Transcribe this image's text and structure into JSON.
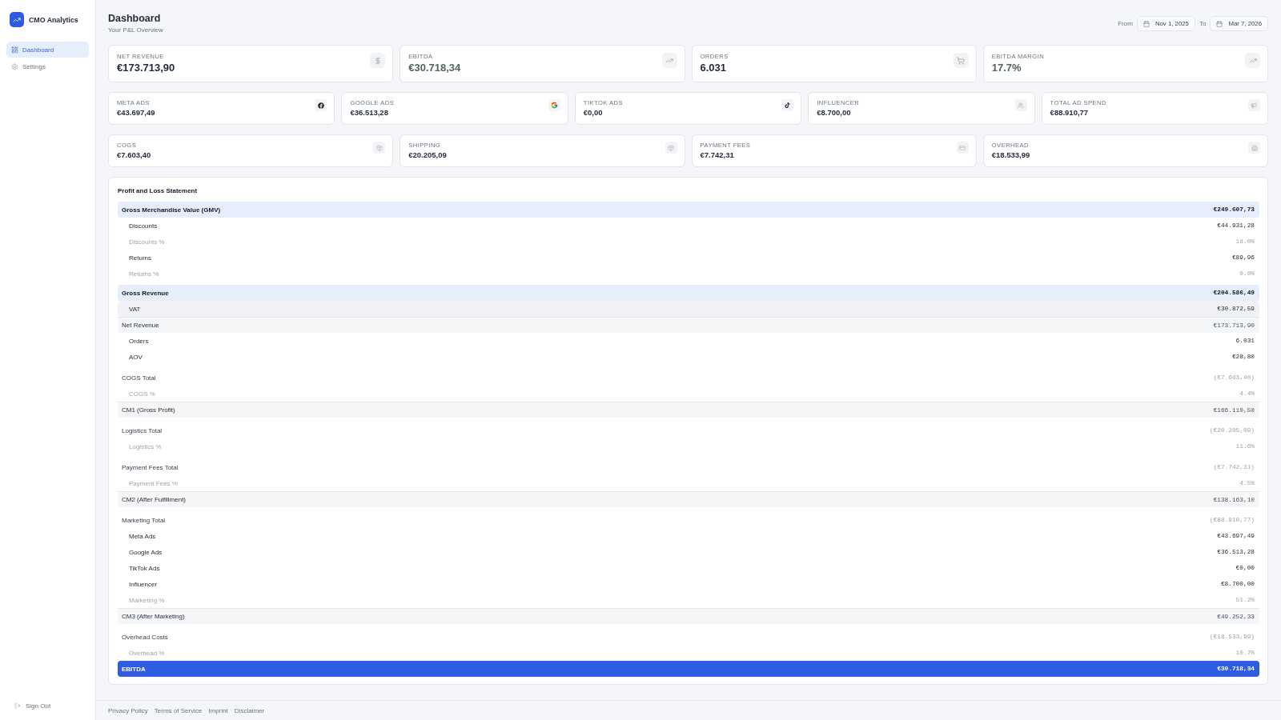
{
  "sidebar": {
    "brand": "CMO Analytics",
    "nav": [
      {
        "label": "Dashboard",
        "selected": true
      },
      {
        "label": "Settings",
        "selected": false
      }
    ],
    "sign_out": "Sign Out"
  },
  "header": {
    "title": "Dashboard",
    "subtitle": "Your P&L Overview",
    "date_range": {
      "from_label": "From",
      "from": "Nov 1, 2025",
      "to_label": "To",
      "to": "Mar 7, 2026"
    }
  },
  "summary_cards": [
    {
      "label": "NET REVENUE",
      "value": "€173.713,90",
      "muted": false
    },
    {
      "label": "EBITDA",
      "value": "€30.718,34",
      "muted": true
    },
    {
      "label": "ORDERS",
      "value": "6.031",
      "muted": false
    },
    {
      "label": "EBITDA MARGIN",
      "value": "17.7%",
      "muted": true
    }
  ],
  "ad_spend_cards": [
    {
      "label": "META ADS",
      "value": "€43.697,49"
    },
    {
      "label": "GOOGLE ADS",
      "value": "€36.513,28"
    },
    {
      "label": "TIKTOK ADS",
      "value": "€0,00"
    },
    {
      "label": "INFLUENCER",
      "value": "€8.700,00"
    },
    {
      "label": "TOTAL AD SPEND",
      "value": "€88.910,77"
    }
  ],
  "cost_cards": [
    {
      "label": "COGS",
      "value": "€7.603,40"
    },
    {
      "label": "SHIPPING",
      "value": "€20.205,09"
    },
    {
      "label": "PAYMENT FEES",
      "value": "€7.742,31"
    },
    {
      "label": "OVERHEAD",
      "value": "€18.533,99"
    }
  ],
  "pnl": {
    "title": "Profit and Loss Statement",
    "rows": [
      {
        "label": "Gross Merchandise Value (GMV)",
        "value": "€249.607,73",
        "kind": "header",
        "children": [
          {
            "label": "Discounts",
            "value": "€44.931,28",
            "kind": "item",
            "hovered": false
          },
          {
            "label": "Discounts %",
            "value": "18.0%",
            "kind": "percent",
            "hovered": false
          },
          {
            "label": "Returns",
            "value": "€89,96",
            "kind": "item",
            "hovered": false
          },
          {
            "label": "Returns %",
            "value": "0.0%",
            "kind": "percent",
            "hovered": false
          }
        ]
      },
      {
        "label": "Gross Revenue",
        "value": "€204.586,49",
        "kind": "header",
        "children": [
          {
            "label": "VAT",
            "value": "€30.872,59",
            "kind": "item",
            "hovered": true
          }
        ]
      },
      {
        "label": "Net Revenue",
        "value": "€173.713,90",
        "kind": "subtotal",
        "children": [
          {
            "label": "Orders",
            "value": "6.031",
            "kind": "item",
            "hovered": false
          },
          {
            "label": "AOV",
            "value": "€28,80",
            "kind": "item",
            "hovered": false
          }
        ]
      },
      {
        "label": "COGS Total",
        "value": "(€7.603,40)",
        "kind": "total",
        "children": [
          {
            "label": "COGS %",
            "value": "4.4%",
            "kind": "percent",
            "hovered": false
          }
        ]
      },
      {
        "label": "CM1 (Gross Profit)",
        "value": "€166.110,50",
        "kind": "subtotal"
      },
      {
        "label": "Logistics Total",
        "value": "(€20.205,09)",
        "kind": "total",
        "children": [
          {
            "label": "Logistics %",
            "value": "11.6%",
            "kind": "percent",
            "hovered": false
          }
        ]
      },
      {
        "label": "Payment Fees Total",
        "value": "(€7.742,31)",
        "kind": "total",
        "children": [
          {
            "label": "Payment Fees %",
            "value": "4.5%",
            "kind": "percent",
            "hovered": false
          }
        ]
      },
      {
        "label": "CM2 (After Fulfillment)",
        "value": "€138.163,10",
        "kind": "subtotal"
      },
      {
        "label": "Marketing Total",
        "value": "(€88.910,77)",
        "kind": "total",
        "children": [
          {
            "label": "Meta Ads",
            "value": "€43.697,49",
            "kind": "item",
            "hovered": false
          },
          {
            "label": "Google Ads",
            "value": "€36.513,28",
            "kind": "item",
            "hovered": false
          },
          {
            "label": "TikTok Ads",
            "value": "€0,00",
            "kind": "item",
            "hovered": false
          },
          {
            "label": "Influencer",
            "value": "€8.700,00",
            "kind": "item",
            "hovered": false
          },
          {
            "label": "Marketing %",
            "value": "51.2%",
            "kind": "percent",
            "hovered": false
          }
        ]
      },
      {
        "label": "CM3 (After Marketing)",
        "value": "€49.252,33",
        "kind": "subtotal"
      },
      {
        "label": "Overhead Costs",
        "value": "(€18.533,99)",
        "kind": "total",
        "children": [
          {
            "label": "Overhead %",
            "value": "10.7%",
            "kind": "percent",
            "hovered": false
          }
        ]
      },
      {
        "label": "EBITDA",
        "value": "€30.718,34",
        "kind": "result"
      }
    ]
  },
  "footer": {
    "links": [
      "Privacy Policy",
      "Terms of Service",
      "Imprint",
      "Disclaimer"
    ]
  }
}
